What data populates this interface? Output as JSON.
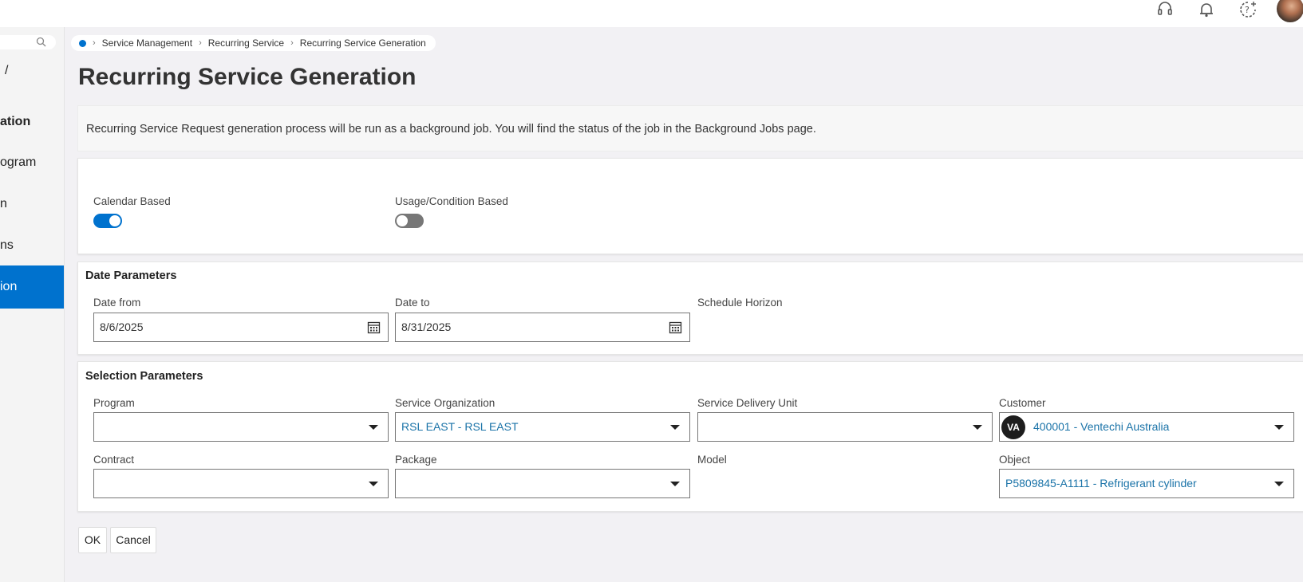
{
  "header": {
    "icons": [
      "headset-icon",
      "bell-icon",
      "help-icon"
    ]
  },
  "sidebar": {
    "items": [
      {
        "label": "/"
      },
      {
        "label": "ation"
      },
      {
        "label": "ogram"
      },
      {
        "label": "n"
      },
      {
        "label": "ns"
      },
      {
        "label": "ion"
      }
    ]
  },
  "breadcrumb": {
    "items": [
      "Service Management",
      "Recurring Service",
      "Recurring Service Generation"
    ]
  },
  "page": {
    "title": "Recurring Service Generation",
    "info": "Recurring Service Request generation process will be run as a background job. You will find the status of the job in the Background Jobs page."
  },
  "options": {
    "calendar_based": {
      "label": "Calendar Based",
      "on": true
    },
    "usage_based": {
      "label": "Usage/Condition Based",
      "on": false
    }
  },
  "date_params": {
    "title": "Date Parameters",
    "date_from": {
      "label": "Date from",
      "value": "8/6/2025"
    },
    "date_to": {
      "label": "Date to",
      "value": "8/31/2025"
    },
    "schedule_horizon": {
      "label": "Schedule Horizon"
    }
  },
  "selection_params": {
    "title": "Selection Parameters",
    "program": {
      "label": "Program",
      "value": ""
    },
    "service_org": {
      "label": "Service Organization",
      "value": "RSL EAST - RSL EAST"
    },
    "sdu": {
      "label": "Service Delivery Unit",
      "value": ""
    },
    "customer": {
      "label": "Customer",
      "badge": "VA",
      "value": "400001 - Ventechi Australia"
    },
    "contract": {
      "label": "Contract",
      "value": ""
    },
    "package": {
      "label": "Package",
      "value": ""
    },
    "model": {
      "label": "Model"
    },
    "object": {
      "label": "Object",
      "value": "P5809845-A1111 - Refrigerant cylinder"
    }
  },
  "actions": {
    "ok": "OK",
    "cancel": "Cancel"
  },
  "colors": {
    "accent": "#0072ce",
    "link": "#1a73a8",
    "background": "#f2f1f4"
  }
}
